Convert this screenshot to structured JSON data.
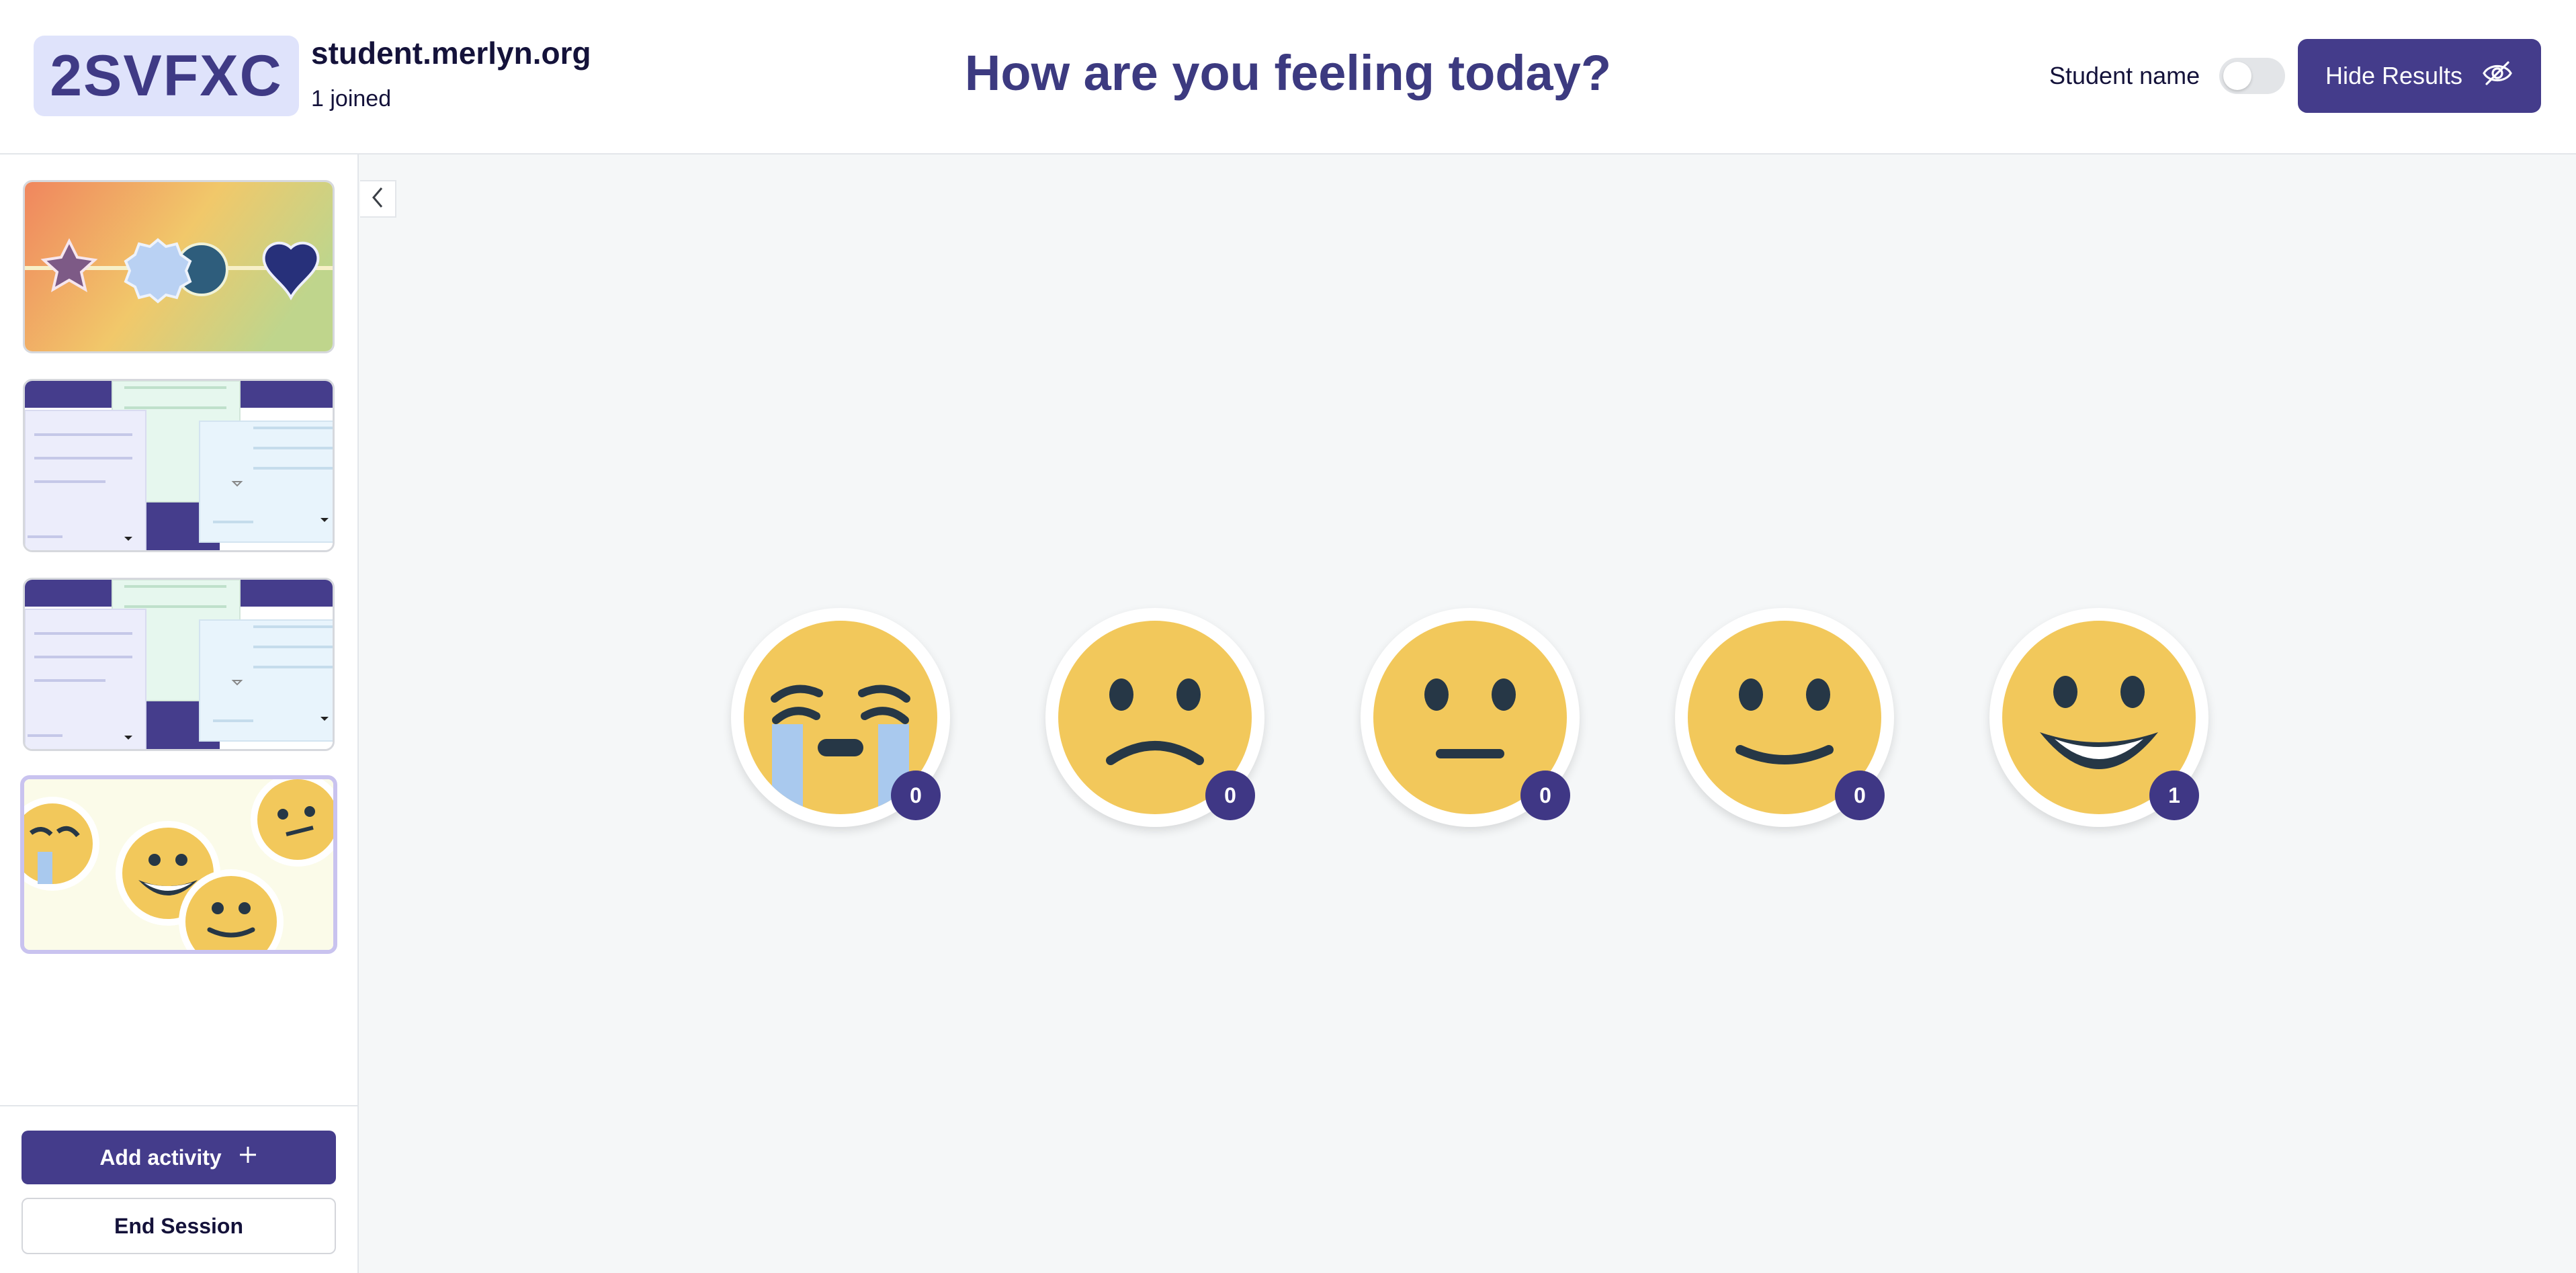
{
  "header": {
    "session_code": "2SVFXC",
    "join_url": "student.merlyn.org",
    "joined_text": "1 joined",
    "title": "How are you feeling today?",
    "student_name_label": "Student name",
    "student_name_toggle_on": false,
    "hide_results_label": "Hide Results",
    "hide_results_icon": "eye-off-icon"
  },
  "sidebar": {
    "collapse_icon": "chevron-left-icon",
    "thumbnails": [
      {
        "name": "shapes-activity"
      },
      {
        "name": "cards-activity"
      },
      {
        "name": "cards-activity-2"
      },
      {
        "name": "emoji-activity",
        "selected": true
      }
    ],
    "add_activity_label": "Add activity",
    "add_activity_icon": "plus-icon",
    "end_session_label": "End Session"
  },
  "responses": [
    {
      "emoji": "crying-face-icon",
      "count": "0"
    },
    {
      "emoji": "frowning-face-icon",
      "count": "0"
    },
    {
      "emoji": "neutral-face-icon",
      "count": "0"
    },
    {
      "emoji": "slightly-smiling-face-icon",
      "count": "0"
    },
    {
      "emoji": "grinning-face-icon",
      "count": "1"
    }
  ],
  "colors": {
    "primary": "#443c8b",
    "title": "#3c3a80",
    "emoji_yellow": "#f2c85b",
    "emoji_feature": "#263746",
    "tear": "#a9c9ee"
  }
}
